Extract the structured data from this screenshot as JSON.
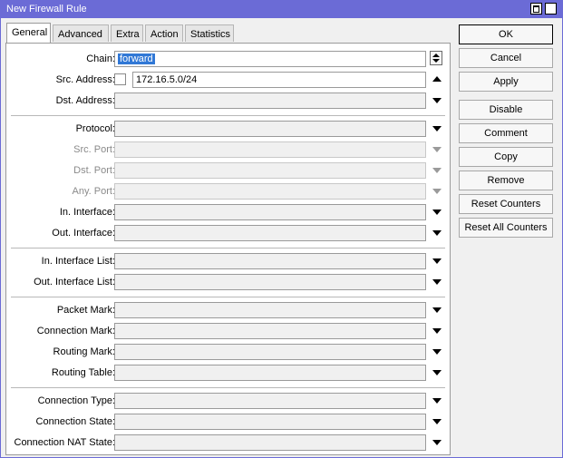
{
  "window": {
    "title": "New Firewall Rule"
  },
  "tabs": [
    "General",
    "Advanced",
    "Extra",
    "Action",
    "Statistics"
  ],
  "fields": {
    "chain": {
      "label": "Chain:",
      "value": "forward"
    },
    "src_address": {
      "label": "Src. Address:",
      "value": "172.16.5.0/24"
    },
    "dst_address": {
      "label": "Dst. Address:"
    },
    "protocol": {
      "label": "Protocol:"
    },
    "src_port": {
      "label": "Src. Port:"
    },
    "dst_port": {
      "label": "Dst. Port:"
    },
    "any_port": {
      "label": "Any. Port:"
    },
    "in_interface": {
      "label": "In. Interface:"
    },
    "out_interface": {
      "label": "Out. Interface:"
    },
    "in_interface_list": {
      "label": "In. Interface List:"
    },
    "out_interface_list": {
      "label": "Out. Interface List:"
    },
    "packet_mark": {
      "label": "Packet Mark:"
    },
    "connection_mark": {
      "label": "Connection Mark:"
    },
    "routing_mark": {
      "label": "Routing Mark:"
    },
    "routing_table": {
      "label": "Routing Table:"
    },
    "connection_type": {
      "label": "Connection Type:"
    },
    "connection_state": {
      "label": "Connection State:"
    },
    "connection_nat_state": {
      "label": "Connection NAT State:"
    }
  },
  "buttons": {
    "ok": "OK",
    "cancel": "Cancel",
    "apply": "Apply",
    "disable": "Disable",
    "comment": "Comment",
    "copy": "Copy",
    "remove": "Remove",
    "reset_counters": "Reset Counters",
    "reset_all_counters": "Reset All Counters"
  },
  "colors": {
    "titlebar": "#6b6bd6",
    "selection": "#3178d6"
  },
  "icons": {
    "maximize": "maximize-icon",
    "close": "close-icon"
  }
}
